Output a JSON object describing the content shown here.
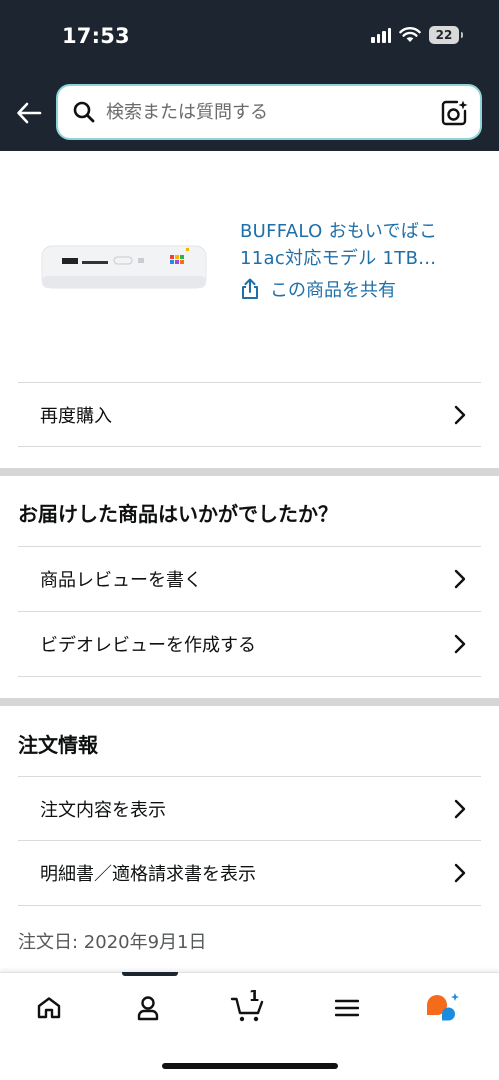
{
  "status_bar": {
    "time": "17:53",
    "battery": "22"
  },
  "header": {
    "search_placeholder": "検索または質問する"
  },
  "product": {
    "title_line1": "BUFFALO おもいでばこ",
    "title_line2": "11ac対応モデル 1TB...",
    "share_label": "この商品を共有"
  },
  "rebuy": {
    "label": "再度購入"
  },
  "feedback": {
    "title": "お届けした商品はいかがでしたか？",
    "items": [
      {
        "label": "商品レビューを書く"
      },
      {
        "label": "ビデオレビューを作成する"
      }
    ]
  },
  "order_info": {
    "title": "注文情報",
    "items": [
      {
        "label": "注文内容を表示"
      },
      {
        "label": "明細書／適格請求書を表示"
      }
    ],
    "order_date": "注文日: 2020年9月1日"
  },
  "bottom_nav": {
    "items": [
      {
        "icon": "home-icon"
      },
      {
        "icon": "account-icon"
      },
      {
        "icon": "cart-icon",
        "count": "1"
      },
      {
        "icon": "menu-icon"
      },
      {
        "icon": "rufus-assistant-icon"
      }
    ]
  },
  "colors": {
    "header_bg": "#1c2530",
    "link": "#1f6fa8",
    "search_border": "#8fd4d8",
    "assistant_orange": "#f46b1c",
    "assistant_blue": "#1a8ce0"
  }
}
